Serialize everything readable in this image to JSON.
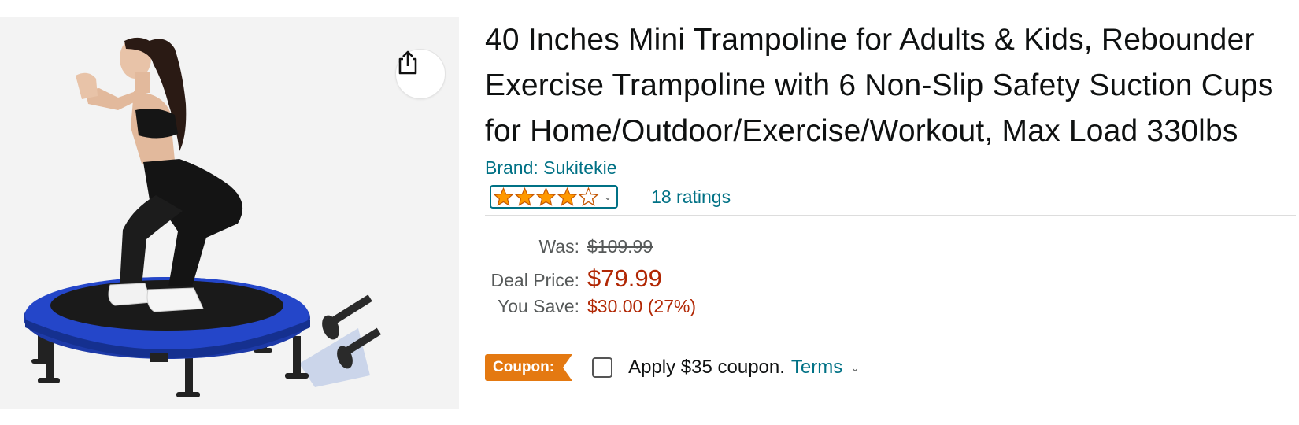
{
  "product": {
    "title": "40 Inches Mini Trampoline for Adults & Kids, Rebounder Exercise Trampoline with 6 Non-Slip Safety Suction Cups for Home/Outdoor/Exercise/Workout, Max Load 330lbs",
    "brand": "Brand: Sukitekie",
    "image_alt_icon": "trampoline-product-image",
    "share_icon": "share-icon"
  },
  "rating": {
    "stars": 4,
    "max_stars": 5,
    "count_text": "18 ratings",
    "star_color": "#ff9900"
  },
  "pricing": {
    "was_label": "Was:",
    "was_value": "$109.99",
    "deal_label": "Deal Price:",
    "deal_value": "$79.99",
    "save_label": "You Save:",
    "save_value": "$30.00 (27%)",
    "price_color": "#b12704"
  },
  "coupon": {
    "badge": "Coupon:",
    "apply_text": "Apply $35 coupon.",
    "terms": "Terms",
    "checked": false,
    "badge_color": "#e47911"
  },
  "colors": {
    "link": "#007185",
    "text": "#0f1111",
    "muted": "#565959"
  }
}
